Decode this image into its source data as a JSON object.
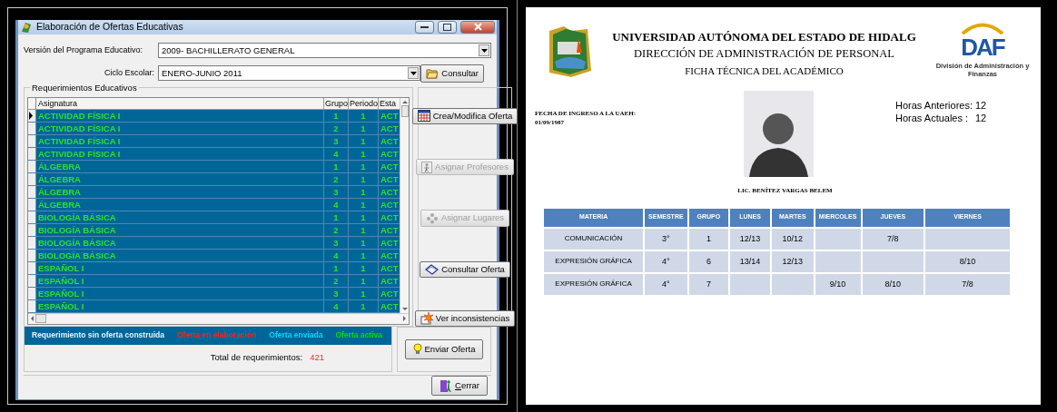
{
  "window": {
    "title": "Elaboración de Ofertas Educativas"
  },
  "fields": [
    {
      "label": "Versión del Programa Educativo:",
      "value": "2009- BACHILLERATO GENERAL"
    },
    {
      "label": "Ciclo Escolar:",
      "value": "ENERO-JUNIO 2011"
    }
  ],
  "consult_button": {
    "label": "Consultar"
  },
  "requirements": {
    "title": "Requerimientos Educativos",
    "columns": [
      "Asignatura",
      "Grupo",
      "Periodo",
      "Esta"
    ],
    "rows": [
      {
        "asignatura": "ACTIVIDAD FÍSICA I",
        "grupo": "1",
        "periodo": "1",
        "estado": "ACT",
        "selected": true
      },
      {
        "asignatura": "ACTIVIDAD FÍSICA I",
        "grupo": "2",
        "periodo": "1",
        "estado": "ACT",
        "selected": false
      },
      {
        "asignatura": "ACTIVIDAD FÍSICA I",
        "grupo": "3",
        "periodo": "1",
        "estado": "ACT",
        "selected": false
      },
      {
        "asignatura": "ACTIVIDAD FÍSICA I",
        "grupo": "4",
        "periodo": "1",
        "estado": "ACT",
        "selected": false
      },
      {
        "asignatura": "ÁLGEBRA",
        "grupo": "1",
        "periodo": "1",
        "estado": "ACT",
        "selected": false
      },
      {
        "asignatura": "ÁLGEBRA",
        "grupo": "2",
        "periodo": "1",
        "estado": "ACT",
        "selected": false
      },
      {
        "asignatura": "ÁLGEBRA",
        "grupo": "3",
        "periodo": "1",
        "estado": "ACT",
        "selected": false
      },
      {
        "asignatura": "ÁLGEBRA",
        "grupo": "4",
        "periodo": "1",
        "estado": "ACT",
        "selected": false
      },
      {
        "asignatura": "BIOLOGÍA BÁSICA",
        "grupo": "1",
        "periodo": "1",
        "estado": "ACT",
        "selected": false
      },
      {
        "asignatura": "BIOLOGÍA BÁSICA",
        "grupo": "2",
        "periodo": "1",
        "estado": "ACT",
        "selected": false
      },
      {
        "asignatura": "BIOLOGÍA BÁSICA",
        "grupo": "3",
        "periodo": "1",
        "estado": "ACT",
        "selected": false
      },
      {
        "asignatura": "BIOLOGÍA BÁSICA",
        "grupo": "4",
        "periodo": "1",
        "estado": "ACT",
        "selected": false
      },
      {
        "asignatura": "ESPAÑOL I",
        "grupo": "1",
        "periodo": "1",
        "estado": "ACT",
        "selected": false
      },
      {
        "asignatura": "ESPAÑOL I",
        "grupo": "2",
        "periodo": "1",
        "estado": "ACT",
        "selected": false
      },
      {
        "asignatura": "ESPAÑOL I",
        "grupo": "3",
        "periodo": "1",
        "estado": "ACT",
        "selected": false
      },
      {
        "asignatura": "ESPAÑOL I",
        "grupo": "4",
        "periodo": "1",
        "estado": "ACT",
        "selected": false
      }
    ]
  },
  "legend": [
    {
      "label": "Requerimiento sin oferta construida",
      "color": "#e8f4ff"
    },
    {
      "label": "Oferta en elaboración",
      "color": "#ff2020"
    },
    {
      "label": "Oferta enviada",
      "color": "#00d8ff"
    },
    {
      "label": "Oferta activa",
      "color": "#00e000"
    }
  ],
  "total": {
    "label": "Total de requerimientos:",
    "value": "421"
  },
  "actions": [
    {
      "label": "Crea/Modifica Oferta",
      "kind": "calendar",
      "disabled": false
    },
    {
      "label": "Asignar Profesores",
      "kind": "person",
      "disabled": true
    },
    {
      "label": "Asignar Lugares",
      "kind": "group",
      "disabled": true
    },
    {
      "label": "Consultar Oferta",
      "kind": "book",
      "disabled": false
    },
    {
      "label": "Ver inconsistencias",
      "kind": "burst",
      "disabled": false
    }
  ],
  "send_button": {
    "label": "Enviar Oferta"
  },
  "close_button": {
    "label": "Cerrar"
  },
  "document": {
    "title": "UNIVERSIDAD AUTÓNOMA DEL ESTADO DE HIDALG",
    "subtitle": "DIRECCIÓN DE ADMINISTRACIÓN DE PERSONAL",
    "heading": "FICHA TÉCNICA DEL ACADÉMICO",
    "logo_text": "DAF",
    "logo_caption": "División de Administración y Finanzas",
    "hire_label": "FECHA DE INGRESO A LA UAEH:",
    "hire_date": "01/09/1987",
    "hours": [
      {
        "label": "Horas Anteriores:",
        "value": "12"
      },
      {
        "label": "Horas Actuales :",
        "value": "12"
      }
    ],
    "name": "LIC. BENÍTEZ VARGAS BELEM",
    "schedule": {
      "columns": [
        "MATERIA",
        "SEMESTRE",
        "GRUPO",
        "LUNES",
        "MARTES",
        "MIERCOLES",
        "JUEVES",
        "VIERNES"
      ],
      "rows": [
        [
          "COMUNICACIÓN",
          "3°",
          "1",
          "12/13",
          "10/12",
          null,
          "7/8",
          null
        ],
        [
          "EXPRESIÓN GRÁFICA",
          "4°",
          "6",
          "13/14",
          "12/13",
          null,
          null,
          "8/10"
        ],
        [
          "EXPRESIÓN GRÁFICA",
          "4°",
          "7",
          null,
          null,
          "9/10",
          "8/10",
          "7/8"
        ]
      ]
    }
  }
}
